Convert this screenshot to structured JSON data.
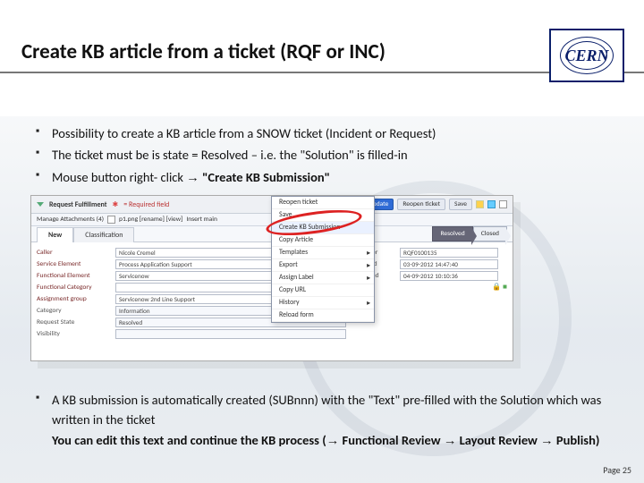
{
  "title": "Create KB article from a ticket (RQF or INC)",
  "logo_text": "CERN",
  "bullets_top": [
    "Possibility  to create a KB article from a SNOW ticket (Incident or Request)",
    "The ticket must be is state = Resolved – i.e. the \"Solution\" is filled-in"
  ],
  "bullet_top_3_prefix": "Mouse button right- click ",
  "bullet_top_3_bold": "\"Create KB Submission\"",
  "bullet_bottom_main": "A  KB submission is automatically created (SUBnnn) with the \"Text\"  pre-filled with the Solution which was written in the  ticket",
  "bullet_bottom_line2_a": " You can edit this text and continue the KB process (",
  "bullet_bottom_line2_b": " Functional Review ",
  "bullet_bottom_line2_c": " Layout Review ",
  "bullet_bottom_line2_d": " Publish)",
  "arrow": "→",
  "page_label": "Page 25",
  "shot": {
    "header_label": "Request Fulfillment",
    "required_label": "= Required field",
    "toolbar_buttons": {
      "update": "Update",
      "reopen": "Reopen ticket",
      "save": "Save"
    },
    "toolbar2_prefix": "Manage Attachments (4)",
    "toolbar2_files": "p1.png  [rename]  [view]",
    "toolbar2_rest": "  Insert   main",
    "tabs": [
      "New",
      "Classification"
    ],
    "steps": {
      "resolved": "Resolved",
      "closed": "Closed"
    },
    "rows_left": [
      {
        "label": "Caller",
        "value": "Nicole Cremel"
      },
      {
        "label": "Service Element",
        "value": "Process Application Support"
      },
      {
        "label": "Functional Element",
        "value": "Servicenow"
      },
      {
        "label": "Functional Category",
        "value": ""
      },
      {
        "label": "Assignment group",
        "value": "Servicenow 2nd Line Support"
      },
      {
        "label": "Category",
        "value": "Information"
      },
      {
        "label": "Request State",
        "value": "Resolved"
      },
      {
        "label": "Visibility",
        "value": ""
      }
    ],
    "rows_right": [
      {
        "label": "Number",
        "value": "RQF0100135"
      },
      {
        "label": "Opened",
        "value": "03-09-2012 14:47:40"
      },
      {
        "label": "Updated",
        "value": "04-09-2012 10:10:36"
      },
      {
        "label": "",
        "value": ""
      }
    ],
    "ctx": [
      "Reopen ticket",
      "Save",
      "Create KB Submission",
      "Copy Article",
      "Templates",
      "Export",
      "Assign Label",
      "Copy URL",
      "History",
      "Reload form"
    ]
  }
}
